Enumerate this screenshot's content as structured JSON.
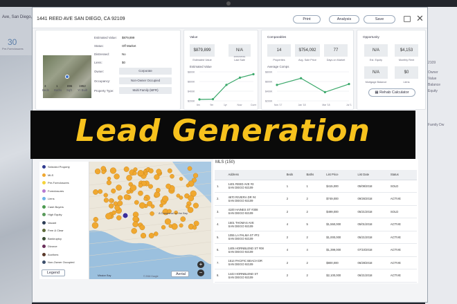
{
  "background_left": {
    "address": "Ave, San Diego, CA",
    "count": "30",
    "count_label": "Pre-Foreclosures"
  },
  "background_right": {
    "lines": [
      "2109",
      "Owner",
      "Value",
      "Balance",
      "Equity",
      "Family Dw"
    ]
  },
  "header": {
    "address": "1441 REED AVE SAN DIEGO, CA 92109",
    "print_label": "Print",
    "analysis_label": "Analysis",
    "save_label": "Save"
  },
  "property": {
    "estimated_value_label": "Estimated Value:",
    "estimated_value": "$879,899",
    "status_label": "Status:",
    "status": "Off Market",
    "distressed_label": "Distressed:",
    "distressed": "No",
    "liens_label": "Liens:",
    "liens": "$0",
    "owner_label": "Owner:",
    "owner": "Corporate",
    "occupancy_label": "Occupancy:",
    "occupancy": "Non-Owner Occupied",
    "type_label": "Property Type:",
    "type": "Multi Family (MFR)",
    "facts": [
      {
        "value": "3",
        "label": "Beds"
      },
      {
        "value": "1",
        "label": "Baths"
      },
      {
        "value": "896",
        "label": "Sqft"
      },
      {
        "value": "1952",
        "label": "Yr Built"
      }
    ]
  },
  "value_card": {
    "title": "Value",
    "estimated": "$879,899",
    "estimated_label": "Estimated Value",
    "last_sale": "N/A",
    "last_sale_sub": "(04/12/2011)",
    "last_sale_label": "Last Sale",
    "chart_title": "Estimated Value",
    "y_ticks": [
      "$800K",
      "$600K",
      "$400K",
      "$200K"
    ],
    "x_ticks": [
      "6m",
      "9m",
      "1yr",
      "Now",
      "Current"
    ]
  },
  "comparables": {
    "title": "Comparables",
    "properties": "14",
    "properties_label": "Properties",
    "avg_price": "$754,092",
    "avg_price_label": "Avg. Sale Price",
    "dom": "77",
    "dom_label": "Days on Market",
    "chart_title": "Average Comps",
    "y_ticks": [
      "$800K",
      "$600K",
      "$400K",
      "$200K"
    ],
    "x_ticks": [
      "Nov '17",
      "Jan '18",
      "Mar '18",
      "Jul '18"
    ]
  },
  "opportunity": {
    "title": "Opportunity",
    "equity": "N/A",
    "equity_label": "Est. Equity",
    "rent": "$4,153",
    "rent_label": "Monthly Rent",
    "mortgage": "N/A",
    "mortgage_label": "Mortgage Balance",
    "liens": "$0",
    "liens_label": "Liens",
    "rehab_label": "Rehab Calculator"
  },
  "banner": {
    "text": "Lead Generation"
  },
  "map": {
    "legend": [
      {
        "label": "Selected Property",
        "color": "#2f3a8f"
      },
      {
        "label": "MLS",
        "color": "#f0a830"
      },
      {
        "label": "Pre-Foreclosures",
        "color": "#f5d33a"
      },
      {
        "label": "Foreclosures",
        "color": "#b57bd1"
      },
      {
        "label": "Liens",
        "color": "#6db4e8"
      },
      {
        "label": "Cash Buyers",
        "color": "#4c9a4f"
      },
      {
        "label": "High Equity",
        "color": "#5a9a5c"
      },
      {
        "label": "Vacant",
        "color": "#2d3d55"
      },
      {
        "label": "Free & Clear",
        "color": "#5e6b3a"
      },
      {
        "label": "Bankruptcy",
        "color": "#3b4d34"
      },
      {
        "label": "Divorce",
        "color": "#6a2e5a"
      },
      {
        "label": "Auctions",
        "color": "#5a3a2a"
      },
      {
        "label": "Non-Owner Occupied",
        "color": "#3c4f6b"
      }
    ],
    "legend_button": "Legend",
    "aerial_label": "Aerial",
    "place_label": "A Campanal on the Bay",
    "bay_label": "Mission Bay",
    "credit": "© 2018 Google"
  },
  "mls": {
    "title": "MLS (150)",
    "columns": [
      "",
      "Address",
      "Beds",
      "Baths",
      "List Price",
      "List Date",
      "Status"
    ],
    "rows": [
      [
        "1.",
        "1401 REED AVE #3",
        "SAN DIEGO 92109",
        "1",
        "1",
        "$415,000",
        "05/08/2018",
        "SOLD"
      ],
      [
        "2.",
        "4670 RIVIERA DR #4",
        "SAN DIEGO 92109",
        "2",
        "2",
        "$749,000",
        "09/26/2018",
        "ACTIVE"
      ],
      [
        "3.",
        "4100 HAINES ST #308",
        "SAN DIEGO 92109",
        "2",
        "2",
        "$499,000",
        "05/21/2018",
        "SOLD"
      ],
      [
        "4.",
        "1501 THOMAS AVE",
        "SAN DIEGO 92109",
        "4",
        "5",
        "$1,550,000",
        "05/01/2018",
        "ACTIVE"
      ],
      [
        "5.",
        "1055 LA PALMA ST #F2",
        "SAN DIEGO 92109",
        "2",
        "2",
        "$1,000,000",
        "05/21/2018",
        "ACTIVE"
      ],
      [
        "6.",
        "1405 HORNBLEND ST #08",
        "SAN DIEGO 92109",
        "4",
        "4",
        "$1,399,000",
        "07/10/2018",
        "ACTIVE"
      ],
      [
        "7.",
        "1514 PACIFIC BEACH DR",
        "SAN DIEGO 92109",
        "2",
        "2",
        "$800,000",
        "06/28/2018",
        "ACTIVE"
      ],
      [
        "8.",
        "1443 HORNBLEND ST",
        "SAN DIEGO 92109",
        "2",
        "2",
        "$2,100,000",
        "06/21/2018",
        "ACTIVE"
      ]
    ]
  },
  "colors": {
    "accent": "#f7c21d",
    "line": "#3aa86a",
    "cluster": "#f0a830"
  }
}
